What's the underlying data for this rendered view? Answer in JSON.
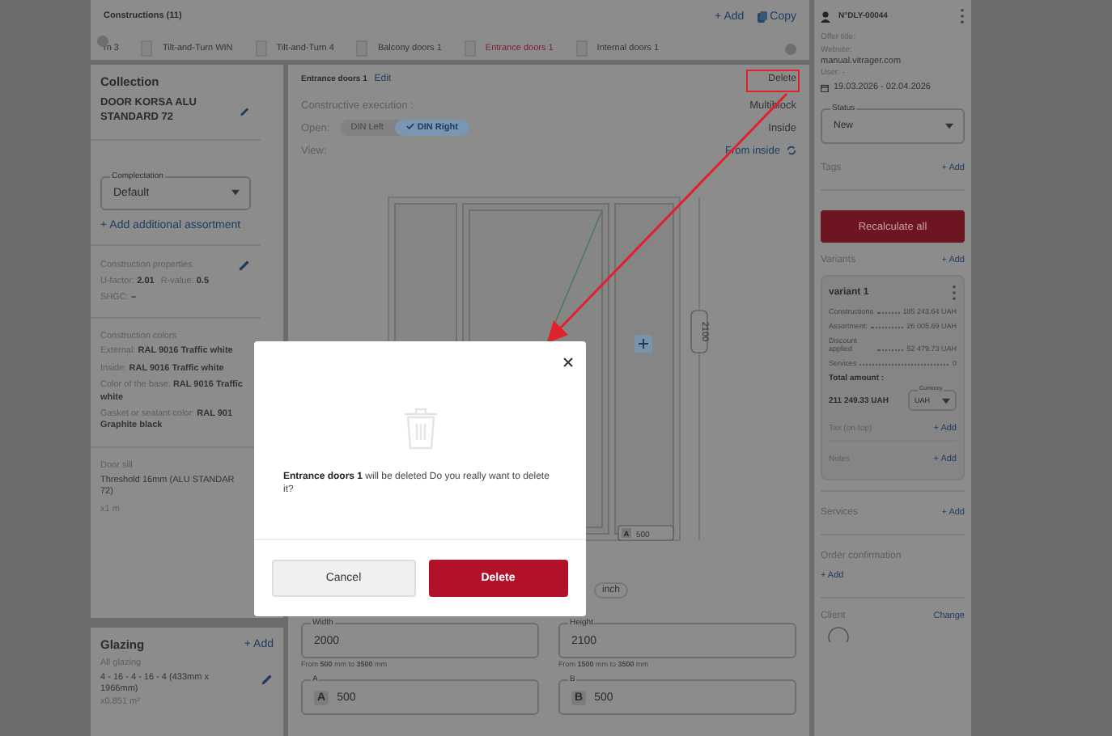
{
  "constructions": {
    "title": "Constructions (11)",
    "add": "+ Add",
    "copy": "Copy",
    "tabs": [
      {
        "label": "rn 3",
        "selected": false
      },
      {
        "label": "Tilt-and-Turn WIN",
        "selected": false
      },
      {
        "label": "Tilt-and-Turn 4",
        "selected": false
      },
      {
        "label": "Balcony doors 1",
        "selected": false
      },
      {
        "label": "Entrance doors 1",
        "selected": true
      },
      {
        "label": "Internal doors 1",
        "selected": false
      }
    ]
  },
  "collection": {
    "title": "Collection",
    "name": "DOOR KORSA ALU STANDARD 72",
    "complectation": {
      "label": "Complectation",
      "value": "Default"
    },
    "add_assortment": "+ Add additional assortment",
    "properties": {
      "title": "Construction properties",
      "items": [
        "U-factor: **2.01**",
        "R-value: **0.5**",
        "SHGC: **–**"
      ]
    },
    "colors": {
      "title": "Construction colors",
      "items": [
        {
          "label": "External:",
          "value": "RAL 9016 Traffic white"
        },
        {
          "label": "Inside:",
          "value": "RAL 9016 Traffic white"
        },
        {
          "label": "Color of the base:",
          "value": "RAL 9016 Traffic",
          "continuation": "white"
        },
        {
          "label": "Gasket or sealant color:",
          "value": "RAL 901",
          "continuation": "Graphite black"
        }
      ]
    },
    "door_sill": {
      "title": "Door sill",
      "value": "Threshold 16mm (ALU STANDAR",
      "continuation": "72)",
      "quantity": "x1 m"
    }
  },
  "glazing": {
    "title": "Glazing",
    "add": "+ Add",
    "subtitle": "All glazing",
    "value": "4 - 16 - 4 - 16 - 4 (433mm x 1966mm)",
    "area": "x0.851 m²"
  },
  "construction": {
    "title": "Entrance doors 1",
    "edit": "Edit",
    "delete": "Delete",
    "execution_label": "Constructive execution :",
    "execution_value": "Multiblock",
    "open_label": "Open:",
    "open_options": [
      {
        "label": "DIN Left",
        "selected": false
      },
      {
        "label": "DIN Right",
        "selected": true
      }
    ],
    "open_value": "Inside",
    "view_label": "View:",
    "view_value": "From inside",
    "height_dim": "2100",
    "width_tag": "500",
    "width_tag_letter": "A",
    "unit": "inch",
    "fields": [
      {
        "label": "Width",
        "value": "2000",
        "hint": "From **500** mm to **3500** mm"
      },
      {
        "label": "Height",
        "value": "2100",
        "hint": "From **1500** mm to **3500** mm"
      },
      {
        "label": "A",
        "badge": "A",
        "value": "500"
      },
      {
        "label": "B",
        "badge": "B",
        "value": "500"
      }
    ]
  },
  "offer": {
    "number": "N°DLY-00044",
    "title_label": "Offer title:",
    "website_label": "Website:",
    "website": "manual.vitrager.com",
    "user": "User: -",
    "dates": "19.03.2026 - 02.04.2026",
    "status": {
      "label": "Status",
      "value": "New"
    },
    "tags": "Tags",
    "tags_add": "+ Add",
    "recalculate": "Recalculate all",
    "variants": "Variants",
    "variants_add": "+ Add",
    "variant": {
      "name": "variant 1",
      "rows": [
        {
          "label": "Constructions",
          "value": "185 243.64 UAH"
        },
        {
          "label": "Assortment:",
          "value": "26 005.69 UAH"
        },
        {
          "label": "Discount applied",
          "value": "52 479.73 UAH"
        },
        {
          "label": "Services",
          "value": "0"
        }
      ],
      "total_label": "Total amount :",
      "total": "211 249.33 UAH",
      "currency": {
        "label": "Currency",
        "value": "UAH"
      },
      "tax": "Tax (on-top)",
      "tax_add": "+ Add",
      "notes": "Notes",
      "notes_add": "+ Add"
    },
    "services": "Services",
    "services_add": "+ Add",
    "order_confirmation": "Order confirmation",
    "order_add": "+ Add",
    "client": "Client",
    "client_change": "Change"
  },
  "dialog": {
    "subject": "Entrance doors 1",
    "message": " will be deleted Do you really want to delete it?",
    "cancel": "Cancel",
    "confirm": "Delete"
  }
}
